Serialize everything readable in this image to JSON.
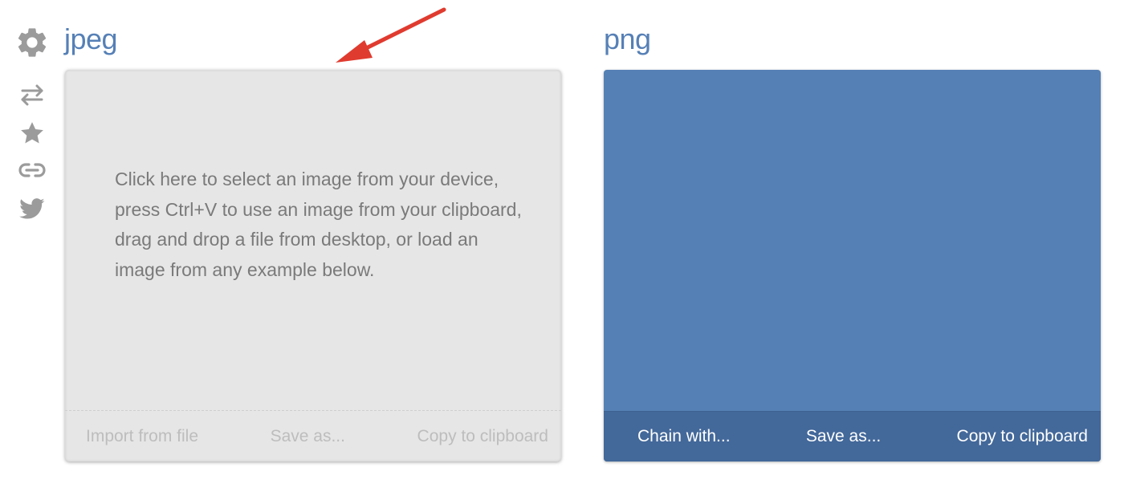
{
  "tools": {
    "icons": [
      "gear-icon",
      "swap-icon",
      "star-icon",
      "link-icon",
      "twitter-icon"
    ]
  },
  "input": {
    "title": "jpeg",
    "instructions": "Click here to select an image from your device, press Ctrl+V to use an image from your clipboard, drag and drop a file from desktop, or load an image from any example below.",
    "actions": {
      "import": "Import from file",
      "save": "Save as...",
      "copy": "Copy to clipboard"
    }
  },
  "output": {
    "title": "png",
    "actions": {
      "chain": "Chain with...",
      "save": "Save as...",
      "copy": "Copy to clipboard"
    }
  },
  "colors": {
    "accent": "#5680b6",
    "output_bg": "#5580b5",
    "output_toolbar": "#43689a",
    "input_bg": "#e6e6e6",
    "annotation_arrow": "#e03b2f",
    "icon_gray": "#9b9b9b"
  }
}
